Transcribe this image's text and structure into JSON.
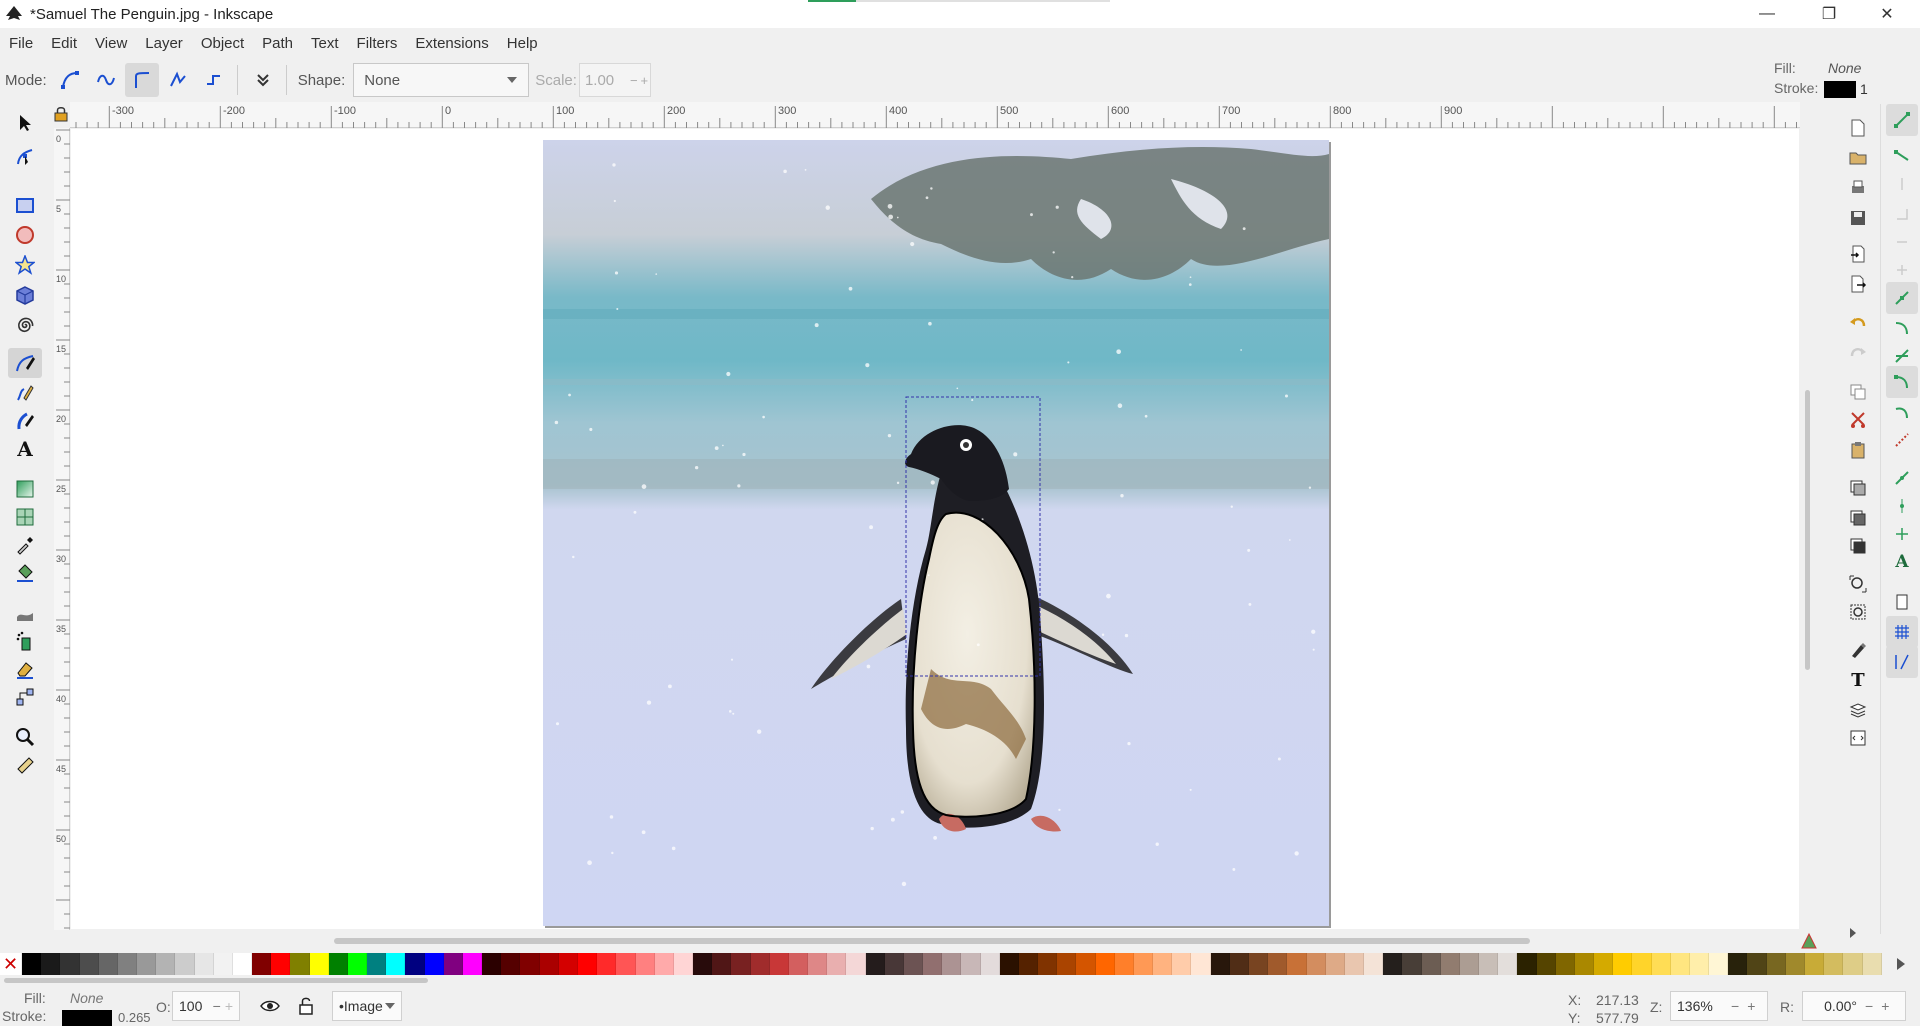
{
  "window": {
    "title": "*Samuel The Penguin.jpg - Inkscape",
    "minimize": "—",
    "maximize": "❐",
    "close": "✕"
  },
  "menu": [
    "File",
    "Edit",
    "View",
    "Layer",
    "Object",
    "Path",
    "Text",
    "Filters",
    "Extensions",
    "Help"
  ],
  "tool_controls": {
    "mode_label": "Mode:",
    "shape_label": "Shape:",
    "shape_value": "None",
    "scale_label": "Scale:",
    "scale_value": "1.00"
  },
  "style_indicator": {
    "fill_label": "Fill:",
    "fill_value": "None",
    "stroke_label": "Stroke:",
    "stroke_width": "1",
    "stroke_color": "#000000"
  },
  "ruler": {
    "h_labels": [
      "-300",
      "-200",
      "-100",
      "0",
      "100",
      "200",
      "300",
      "400",
      "500",
      "600",
      "700",
      "800",
      "900"
    ],
    "v_labels": [
      "0",
      "5",
      "1 0",
      "1 5",
      "2 0",
      "2 5",
      "3 0",
      "3 5",
      "4 0",
      "4 5",
      "5 0"
    ]
  },
  "document": {
    "image_name": "Samuel The Penguin.jpg"
  },
  "statusbar": {
    "fill_label": "Fill:",
    "fill_value": "None",
    "stroke_label": "Stroke:",
    "stroke_width": "0.265",
    "opacity_label": "O:",
    "opacity_value": "100",
    "layer_value": "•Image",
    "x_label": "X:",
    "x_value": "217.13",
    "y_label": "Y:",
    "y_value": "577.79",
    "zoom_label": "Z:",
    "zoom_value": "136%",
    "rotation_label": "R:",
    "rotation_value": "0.00°"
  },
  "progress": {
    "fraction": 0.16
  },
  "colors": {
    "accent": "#2e9e5b",
    "bezier_blue": "#1b4fd1",
    "sky": "#c9cfe9",
    "snow": "#d6dcf5",
    "water": "#6fb6c6"
  },
  "palette": [
    "#000000",
    "#1a1a1a",
    "#333333",
    "#4d4d4d",
    "#666666",
    "#808080",
    "#999999",
    "#b3b3b3",
    "#cccccc",
    "#e6e6e6",
    "#f2f2f2",
    "#ffffff",
    "#800000",
    "#ff0000",
    "#808000",
    "#ffff00",
    "#008000",
    "#00ff00",
    "#008080",
    "#00ffff",
    "#000080",
    "#0000ff",
    "#800080",
    "#ff00ff",
    "#2b0000",
    "#550000",
    "#800000",
    "#aa0000",
    "#d40000",
    "#ff0000",
    "#ff2a2a",
    "#ff5555",
    "#ff8080",
    "#ffaaaa",
    "#ffd5d5",
    "#280b0b",
    "#501616",
    "#782121",
    "#a02c2c",
    "#c83737",
    "#d35f5f",
    "#de8787",
    "#e9afaf",
    "#f4d7d7",
    "#241c1c",
    "#483737",
    "#6c5353",
    "#916f6f",
    "#ac9393",
    "#c8b7b7",
    "#e3dbdb",
    "#2b1100",
    "#552200",
    "#803300",
    "#aa4400",
    "#d45500",
    "#ff6600",
    "#ff7f2a",
    "#ff9955",
    "#ffb380",
    "#ffccaa",
    "#ffe6d5",
    "#28170b",
    "#502d16",
    "#784421",
    "#a05a2c",
    "#c87137",
    "#d38d5f",
    "#deaa87",
    "#e9c6af",
    "#f4e3d7",
    "#241f1c",
    "#483e37",
    "#6c5d53",
    "#917c6f",
    "#ac9d93",
    "#c8beb7",
    "#e3dedb",
    "#2b2200",
    "#554400",
    "#806600",
    "#aa8800",
    "#d4aa00",
    "#ffcc00",
    "#ffd42a",
    "#ffdd55",
    "#ffe680",
    "#ffeeaa",
    "#fff6d5",
    "#28220b",
    "#504416",
    "#786721",
    "#a0892c",
    "#c8ab37",
    "#d3bc5f",
    "#decd87",
    "#e9ddaf"
  ]
}
